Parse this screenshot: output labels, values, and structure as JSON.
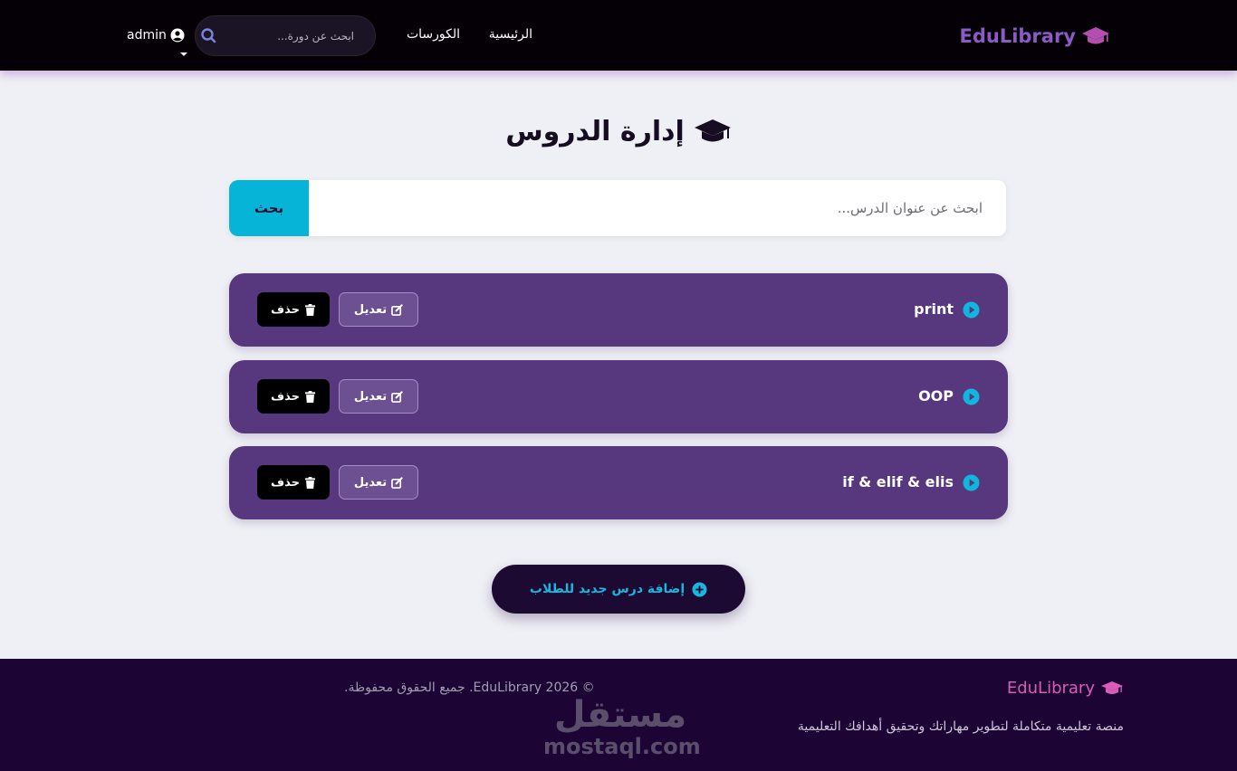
{
  "navbar": {
    "brand": "EduLibrary",
    "links": {
      "home": "الرئيسية",
      "courses": "الكورسات"
    },
    "search_placeholder": "ابحث عن دورة...",
    "user": "admin"
  },
  "main": {
    "title": "إدارة الدروس",
    "search_placeholder": "ابحث عن عنوان الدرس...",
    "search_button": "بحث",
    "lessons": [
      {
        "title": "print",
        "edit_label": "تعديل",
        "delete_label": "حذف"
      },
      {
        "title": "OOP",
        "edit_label": "تعديل",
        "delete_label": "حذف"
      },
      {
        "title": "if & elif & elis",
        "edit_label": "تعديل",
        "delete_label": "حذف"
      }
    ],
    "add_button": "إضافة درس جديد للطلاب"
  },
  "footer": {
    "brand": "EduLibrary",
    "description": "منصة تعليمية متكاملة لتطوير مهاراتك وتحقيق أهدافك التعليمية",
    "copyright": "© EduLibrary 2026. جميع الحقوق محفوظة.",
    "watermark_ar": "مستقل",
    "watermark_en": "mostaql.com"
  },
  "colors": {
    "navbar_bg": "#050006",
    "brand": "#8a5bc4",
    "accent_cyan": "#06b4d8",
    "lesson_card": "#57377d",
    "footer_bg": "#1c0535",
    "footer_brand": "#d85cb8"
  },
  "icons": {
    "brand": "graduation-cap-icon",
    "search": "search-icon",
    "user": "user-circle-icon",
    "lesson": "play-circle-icon",
    "edit": "edit-icon",
    "delete": "trash-icon",
    "add": "plus-circle-icon"
  }
}
